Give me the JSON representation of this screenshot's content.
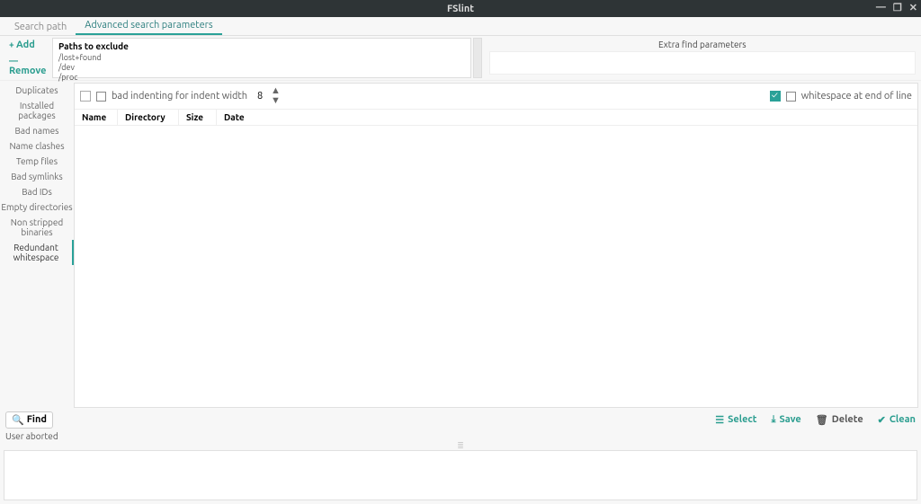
{
  "title": "FSlint",
  "tabs": {
    "search_path": "Search path",
    "advanced": "Advanced search parameters"
  },
  "add_label": "Add",
  "remove_label": "Remove",
  "exclude": {
    "heading": "Paths to exclude",
    "items": [
      "/lost+found",
      "/dev",
      "/proc"
    ]
  },
  "extra_heading": "Extra find parameters",
  "sidebar": {
    "items": [
      "Duplicates",
      "Installed packages",
      "Bad names",
      "Name clashes",
      "Temp files",
      "Bad symlinks",
      "Bad IDs",
      "Empty directories",
      "Non stripped binaries",
      "Redundant whitespace"
    ]
  },
  "options": {
    "indent_label": "bad indenting for indent width",
    "indent_width": "8",
    "eol_label": "whitespace at end of line"
  },
  "table_head": [
    "Name",
    "Directory",
    "Size",
    "Date"
  ],
  "buttons": {
    "find": "Find",
    "select": "Select",
    "save": "Save",
    "delete": "Delete",
    "clean": "Clean"
  },
  "status": "User aborted"
}
